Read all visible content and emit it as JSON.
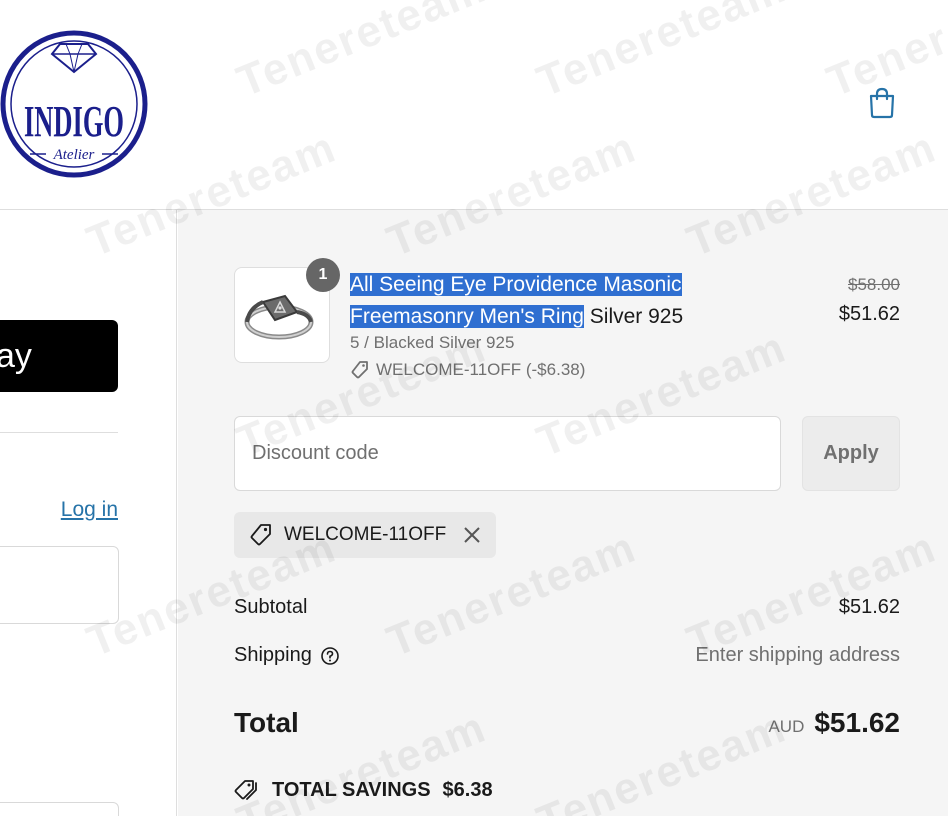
{
  "brand": {
    "name": "INDIGO",
    "subtitle": "Atelier"
  },
  "watermark": "Tenereteam",
  "left": {
    "express_button_label": "ay",
    "login_link": "Log in"
  },
  "order": {
    "item": {
      "quantity": "1",
      "title_highlighted": "All Seeing Eye Providence Masonic Freemasonry Men's Ring",
      "title_rest": " Silver 925",
      "variant": "5 / Blacked Silver 925",
      "discount_line": "WELCOME-11OFF (-$6.38)",
      "price_original": "$58.00",
      "price_final": "$51.62"
    },
    "discount": {
      "placeholder": "Discount code",
      "apply_label": "Apply",
      "applied_code": "WELCOME-11OFF"
    },
    "subtotal_label": "Subtotal",
    "subtotal_value": "$51.62",
    "shipping_label": "Shipping",
    "shipping_value": "Enter shipping address",
    "total_label": "Total",
    "total_currency": "AUD",
    "total_value": "$51.62",
    "savings_label": "TOTAL SAVINGS",
    "savings_value": "$6.38"
  },
  "colors": {
    "brand_navy": "#1b1f8c",
    "link": "#2673a8",
    "highlight": "#2f6fd1",
    "summary_bg": "#f5f5f5"
  },
  "icons": {
    "cart": "shopping-bag-icon",
    "tag": "tag-icon",
    "close": "close-icon",
    "help": "question-circle-icon",
    "savings": "tags-icon"
  }
}
